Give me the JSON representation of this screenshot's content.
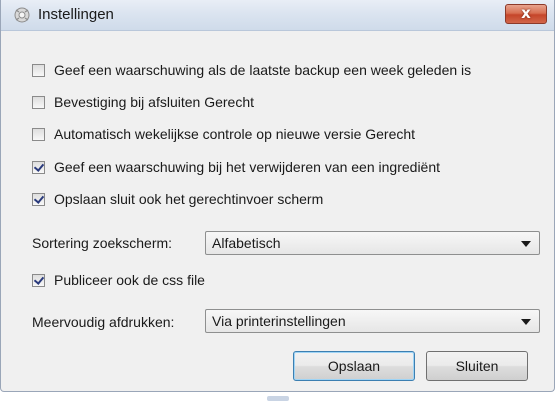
{
  "window": {
    "title": "Instellingen",
    "icon": "settings-app-icon",
    "close_label": "x"
  },
  "options": [
    {
      "label": "Geef een waarschuwing als de laatste backup een week geleden is",
      "checked": false
    },
    {
      "label": "Bevestiging bij afsluiten Gerecht",
      "checked": false
    },
    {
      "label": "Automatisch wekelijkse controle op nieuwe versie Gerecht",
      "checked": false
    },
    {
      "label": "Geef een waarschuwing bij het verwijderen van een ingrediënt",
      "checked": true
    },
    {
      "label": "Opslaan sluit ook het gerechtinvoer scherm",
      "checked": true
    }
  ],
  "sort": {
    "label": "Sortering zoekscherm:",
    "value": "Alfabetisch"
  },
  "publish_css": {
    "label": "Publiceer ook de css file",
    "checked": true
  },
  "print": {
    "label": "Meervoudig afdrukken:",
    "value": "Via printerinstellingen"
  },
  "buttons": {
    "save": "Opslaan",
    "close": "Sluiten"
  }
}
